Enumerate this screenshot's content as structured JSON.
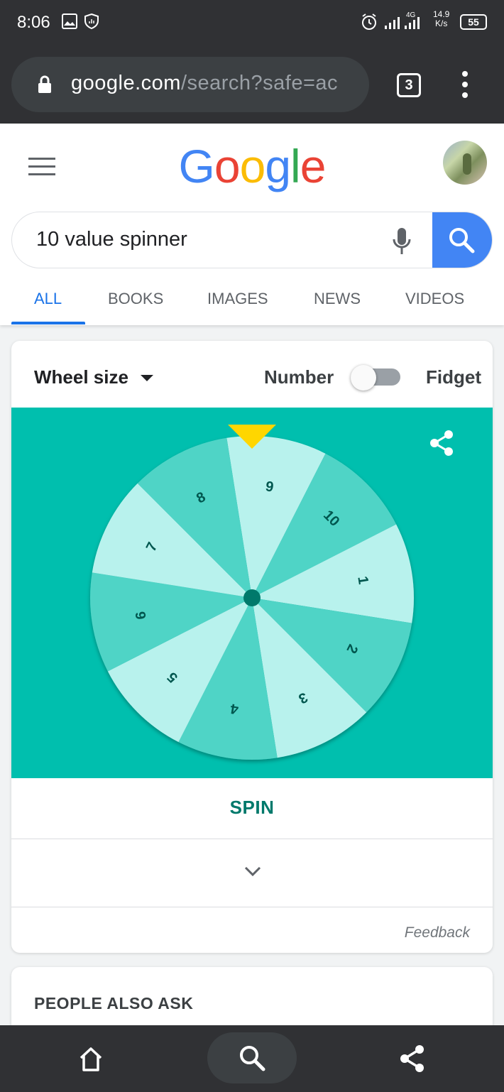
{
  "status_bar": {
    "time": "8:06",
    "net_speed_value": "14.9",
    "net_speed_unit": "K/s",
    "network": "4G",
    "battery": "55",
    "icons": [
      "image-icon",
      "shield-icon",
      "alarm-icon",
      "signal-icon",
      "signal-4g-icon"
    ]
  },
  "browser": {
    "url_host": "google.com",
    "url_rest": "/search?safe=ac",
    "tab_count": "3"
  },
  "header": {
    "logo_letters": [
      {
        "ch": "G",
        "color": "#4285f4"
      },
      {
        "ch": "o",
        "color": "#ea4335"
      },
      {
        "ch": "o",
        "color": "#fbbc05"
      },
      {
        "ch": "g",
        "color": "#4285f4"
      },
      {
        "ch": "l",
        "color": "#34a853"
      },
      {
        "ch": "e",
        "color": "#ea4335"
      }
    ]
  },
  "search": {
    "query": "10 value spinner"
  },
  "tabs": [
    {
      "label": "ALL",
      "active": true
    },
    {
      "label": "BOOKS",
      "active": false
    },
    {
      "label": "IMAGES",
      "active": false
    },
    {
      "label": "NEWS",
      "active": false
    },
    {
      "label": "VIDEOS",
      "active": false
    }
  ],
  "spinner": {
    "wheel_size_label": "Wheel size",
    "mode_left_label": "Number",
    "mode_right_label": "Fidget",
    "toggle_on": false,
    "segment_labels": [
      "9",
      "10",
      "1",
      "2",
      "3",
      "4",
      "5",
      "6",
      "7",
      "8"
    ],
    "colors": {
      "stage": "#00bfae",
      "segment_light": "#b8f2ed",
      "segment_dark": "#4fd4c6",
      "label": "#00574f",
      "hub": "#00796b",
      "pointer": "#ffd600"
    },
    "spin_label": "SPIN",
    "feedback_label": "Feedback"
  },
  "people_also_ask": {
    "title": "PEOPLE ALSO ASK"
  },
  "bottom_nav": {
    "icons": [
      "home-icon",
      "search-icon",
      "share-icon"
    ]
  }
}
